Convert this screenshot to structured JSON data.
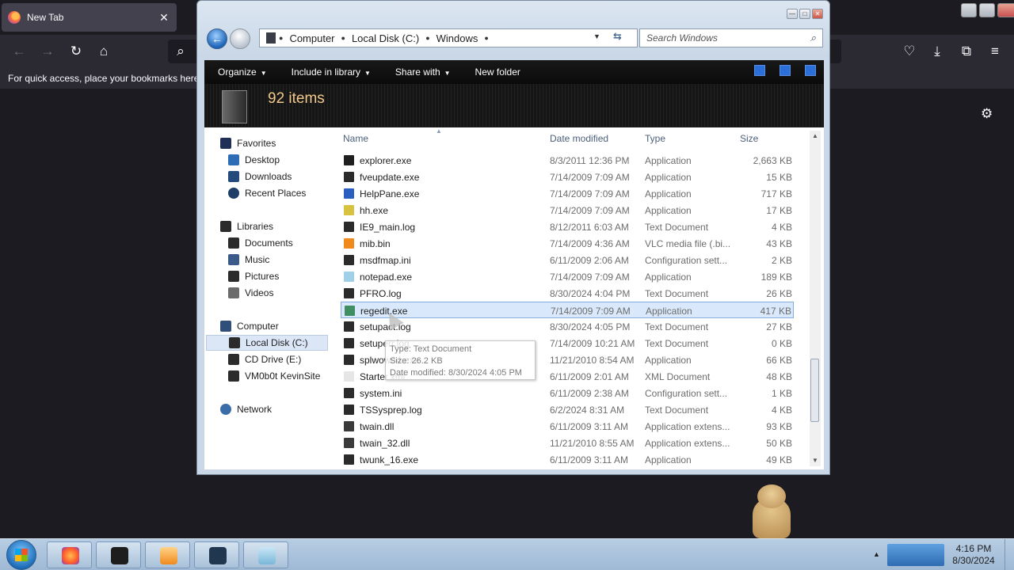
{
  "browser": {
    "tab_title": "New Tab",
    "tab_close": "✕",
    "bookmarks_hint": "For quick access, place your bookmarks here",
    "icons": {
      "back": "←",
      "forward": "→",
      "reload": "↻",
      "home": "⌂",
      "search": "⌕",
      "pocket": "♡",
      "download": "⤓",
      "extensions": "⧉",
      "menu": "≡",
      "settings": "⚙"
    }
  },
  "explorer": {
    "breadcrumb": [
      "Computer",
      "Local Disk (C:)",
      "Windows"
    ],
    "search_placeholder": "Search Windows",
    "toolbar": {
      "organize": "Organize",
      "include_in_library": "Include in library",
      "share_with": "Share with",
      "new_folder": "New folder"
    },
    "item_count": "92 items",
    "sidebar": {
      "favorites": "Favorites",
      "desktop": "Desktop",
      "downloads": "Downloads",
      "recent_places": "Recent Places",
      "libraries": "Libraries",
      "documents": "Documents",
      "music": "Music",
      "pictures": "Pictures",
      "videos": "Videos",
      "computer": "Computer",
      "local_disk": "Local Disk (C:)",
      "cd_drive": "CD Drive (E:)",
      "vm_share": "VM0b0t KevinSite",
      "network": "Network"
    },
    "columns": {
      "name": "Name",
      "date": "Date modified",
      "type": "Type",
      "size": "Size"
    },
    "files": [
      {
        "name": "explorer.exe",
        "date": "8/3/2011 12:36 PM",
        "type": "Application",
        "size": "2,663 KB",
        "color": "#1f1f1f"
      },
      {
        "name": "fveupdate.exe",
        "date": "7/14/2009 7:09 AM",
        "type": "Application",
        "size": "15 KB",
        "color": "#2b2b2b"
      },
      {
        "name": "HelpPane.exe",
        "date": "7/14/2009 7:09 AM",
        "type": "Application",
        "size": "717 KB",
        "color": "#2a5fc1"
      },
      {
        "name": "hh.exe",
        "date": "7/14/2009 7:09 AM",
        "type": "Application",
        "size": "17 KB",
        "color": "#d8c242"
      },
      {
        "name": "IE9_main.log",
        "date": "8/12/2011 6:03 AM",
        "type": "Text Document",
        "size": "4 KB",
        "color": "#2b2b2b"
      },
      {
        "name": "mib.bin",
        "date": "7/14/2009 4:36 AM",
        "type": "VLC media file (.bi...",
        "size": "43 KB",
        "color": "#f08a1c"
      },
      {
        "name": "msdfmap.ini",
        "date": "6/11/2009 2:06 AM",
        "type": "Configuration sett...",
        "size": "2 KB",
        "color": "#2b2b2b"
      },
      {
        "name": "notepad.exe",
        "date": "7/14/2009 7:09 AM",
        "type": "Application",
        "size": "189 KB",
        "color": "#9fd0e8"
      },
      {
        "name": "PFRO.log",
        "date": "8/30/2024 4:04 PM",
        "type": "Text Document",
        "size": "26 KB",
        "color": "#2b2b2b"
      },
      {
        "name": "regedit.exe",
        "date": "7/14/2009 7:09 AM",
        "type": "Application",
        "size": "417 KB",
        "color": "#3f8f63"
      },
      {
        "name": "setupact.log",
        "date": "8/30/2024 4:05 PM",
        "type": "Text Document",
        "size": "27 KB",
        "color": "#2b2b2b"
      },
      {
        "name": "setuperr.log",
        "date": "7/14/2009 10:21 AM",
        "type": "Text Document",
        "size": "0 KB",
        "color": "#2b2b2b"
      },
      {
        "name": "splwow64.exe",
        "date": "11/21/2010 8:54 AM",
        "type": "Application",
        "size": "66 KB",
        "color": "#2b2b2b"
      },
      {
        "name": "Starter.xml",
        "date": "6/11/2009 2:01 AM",
        "type": "XML Document",
        "size": "48 KB",
        "color": "#e6e6e6"
      },
      {
        "name": "system.ini",
        "date": "6/11/2009 2:38 AM",
        "type": "Configuration sett...",
        "size": "1 KB",
        "color": "#2b2b2b"
      },
      {
        "name": "TSSysprep.log",
        "date": "6/2/2024 8:31 AM",
        "type": "Text Document",
        "size": "4 KB",
        "color": "#2b2b2b"
      },
      {
        "name": "twain.dll",
        "date": "6/11/2009 3:11 AM",
        "type": "Application extens...",
        "size": "93 KB",
        "color": "#3a3a3a"
      },
      {
        "name": "twain_32.dll",
        "date": "11/21/2010 8:55 AM",
        "type": "Application extens...",
        "size": "50 KB",
        "color": "#3a3a3a"
      },
      {
        "name": "twunk_16.exe",
        "date": "6/11/2009 3:11 AM",
        "type": "Application",
        "size": "49 KB",
        "color": "#2b2b2b"
      }
    ],
    "selected_file": "regedit.exe",
    "tooltip": {
      "type": "Type: Text Document",
      "size": "Size: 26.2 KB",
      "modified": "Date modified: 8/30/2024 4:05 PM"
    }
  },
  "taskbar": {
    "time": "4:16 PM",
    "date": "8/30/2024"
  }
}
